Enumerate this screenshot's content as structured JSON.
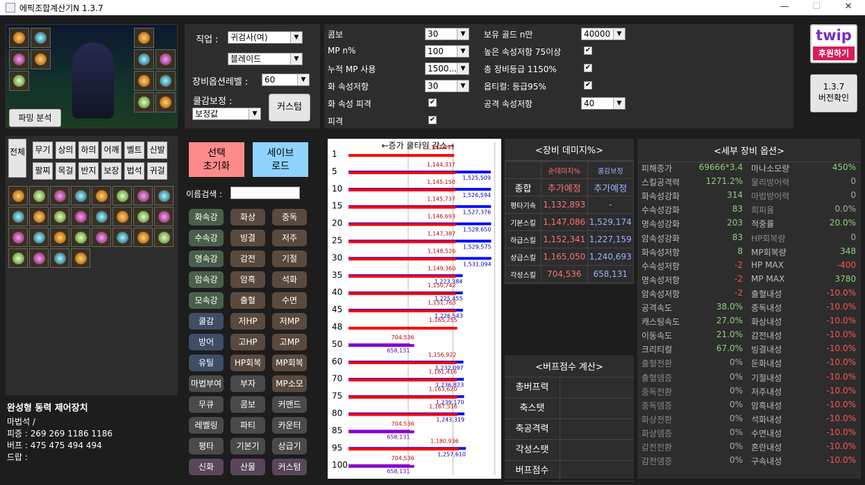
{
  "window": {
    "title": "에픽조합계산기N 1.3.7",
    "minimize": "—",
    "maximize": "☐",
    "close": "✕"
  },
  "preview": {
    "farming_btn": "파밍 분석"
  },
  "job": {
    "label": "직업 :",
    "class_value": "귀검사(여)",
    "subclass_value": "블레이드",
    "level_label": "장비옵션레벨 :",
    "level_value": "60",
    "cool_label": "쿨감보정 :",
    "cool_value": "보정값",
    "custom_btn": "커스텀"
  },
  "params": {
    "left": [
      {
        "label": "콤보",
        "value": "30",
        "type": "combo"
      },
      {
        "label": "MP n%",
        "value": "100",
        "type": "combo"
      },
      {
        "label": "누적 MP 사용",
        "value": "1500...",
        "type": "combo"
      },
      {
        "label": "화 속성저항",
        "value": "30",
        "type": "combo"
      },
      {
        "label": "화 속성 피격",
        "value": "✔",
        "type": "check"
      },
      {
        "label": "피격",
        "value": "✔",
        "type": "check"
      }
    ],
    "right": [
      {
        "label": "보유 골드 n만",
        "value": "40000",
        "type": "combo"
      },
      {
        "label": "높은 속성저항 75이상",
        "value": "✔",
        "type": "check"
      },
      {
        "label": "총 장비등급 1150%",
        "value": "✔",
        "type": "check"
      },
      {
        "label": "옵티컬: 등급95%",
        "value": "✔",
        "type": "check"
      },
      {
        "label": "공격 속성저항",
        "value": "40",
        "type": "combo"
      }
    ]
  },
  "twip": {
    "logo": "twip",
    "support": "후원하기"
  },
  "version_btn": {
    "line1": "1.3.7",
    "line2": "버전확인"
  },
  "slots": {
    "all": "전체",
    "buttons": [
      "무기",
      "상의",
      "하의",
      "어깨",
      "벨트",
      "신발",
      "팔찌",
      "목걸",
      "반지",
      "보장",
      "법석",
      "귀걸"
    ]
  },
  "actions": {
    "reset1": "선택",
    "reset2": "초기화",
    "save1": "세이브",
    "save2": "로드",
    "name_search": "이름검색 :"
  },
  "tags": [
    [
      "화속강",
      "화상",
      "중독",
      "g1",
      "g3",
      "g3"
    ],
    [
      "수속강",
      "빙결",
      "저주",
      "g1",
      "g3",
      "g3"
    ],
    [
      "명속강",
      "감전",
      "기절",
      "g1",
      "g3",
      "g3"
    ],
    [
      "암속강",
      "암흑",
      "석화",
      "g1",
      "g3",
      "g3"
    ],
    [
      "모속강",
      "출혈",
      "수면",
      "g1",
      "g3",
      "g3"
    ],
    [
      "쿨감",
      "저HP",
      "저MP",
      "g2",
      "g3",
      "g3"
    ],
    [
      "방어",
      "고HP",
      "고MP",
      "g2",
      "g3",
      "g3"
    ],
    [
      "유틸",
      "HP회복",
      "MP회복",
      "g2",
      "g3",
      "g3"
    ],
    [
      "마법부여",
      "부자",
      "MP소모",
      "g4",
      "g4",
      "g3"
    ],
    [
      "무큐",
      "콤보",
      "커맨드",
      "g4",
      "g4",
      "g4"
    ],
    [
      "레벨링",
      "파티",
      "카운터",
      "g4",
      "g4",
      "g4"
    ],
    [
      "평타",
      "기본기",
      "상급기",
      "g4",
      "g4",
      "g4"
    ],
    [
      "신화",
      "산물",
      "커스텀",
      "g5",
      "g5",
      "g5"
    ]
  ],
  "item_info": {
    "name": "완성형 동력 제어장치",
    "type": "마법석 /",
    "pijeung": "피증 : 269 269 1186 1186",
    "buff": "버프 : 475 475 494 494",
    "drop": "드랍 :"
  },
  "chart_data": {
    "type": "bar",
    "title": "←증가 쿨타임 감소→",
    "categories": [
      "1",
      "5",
      "10",
      "15",
      "20",
      "25",
      "30",
      "35",
      "40",
      "45",
      "48",
      "50",
      "60",
      "70",
      "75",
      "80",
      "85",
      "95",
      "100"
    ],
    "series": [
      {
        "name": "",
        "color": "#ff0000",
        "values": [
          1132893,
          1144337,
          1145150,
          1145737,
          1146693,
          1147387,
          1148526,
          1149360,
          1150742,
          1151763,
          1165255,
          704536,
          1156922,
          1161416,
          1163620,
          1167516,
          704536,
          1180936,
          704536
        ]
      },
      {
        "name": "",
        "color": "#0000ff",
        "values": [
          null,
          1525509,
          1526594,
          1527376,
          1528650,
          1529575,
          1531094,
          1223384,
          1225455,
          1226543,
          null,
          658131,
          1232097,
          1236823,
          1239170,
          1243319,
          658131,
          1257610,
          658131
        ]
      }
    ],
    "labels_red": [
      "1,132,893",
      "1,144,337",
      "1,145,150",
      "1,145,737",
      "1,146,693",
      "1,147,387",
      "1,148,526",
      "1,149,360",
      "1,150,742",
      "1,151,763",
      "1,165,255",
      "704,536",
      "1,156,922",
      "1,161,416",
      "1,163,620",
      "1,167,516",
      "704,536",
      "1,180,936",
      "704,536"
    ],
    "labels_blue": [
      "",
      "1,525,509",
      "1,526,594",
      "1,527,376",
      "1,528,650",
      "1,529,575",
      "1,531,094",
      "1,223,384",
      "1,225,455",
      "1,226,543",
      "",
      "658,131",
      "1,232,097",
      "1,236,823",
      "1,239,170",
      "1,243,319",
      "658,131",
      "1,257,610",
      "658,131"
    ],
    "purple_rows": [
      11,
      16,
      18
    ],
    "xmax": 1600000
  },
  "damage": {
    "title": "<장비 데미지%>",
    "col1": "순데미지%",
    "col2": "쿨감보정",
    "label_col": "종합",
    "r0": [
      "추가예정",
      "추가예정"
    ],
    "rows": [
      [
        "평타기속",
        "1,132,893",
        "-"
      ],
      [
        "기본스킬",
        "1,147,086",
        "1,529,174"
      ],
      [
        "하급스킬",
        "1,152,341",
        "1,227,159"
      ],
      [
        "상급스킬",
        "1,165,050",
        "1,240,693"
      ],
      [
        "각성스킬",
        "704,536",
        "658,131"
      ]
    ]
  },
  "buffcalc": {
    "title": "<버프점수 계산>",
    "rows": [
      "총버프력",
      "축스탯",
      "축공격력",
      "각성스탯",
      "버프점수"
    ]
  },
  "options": {
    "title": "<세부 장비 옵션>",
    "left": [
      [
        "피해증가",
        "69666*3.4",
        "#8ed17a"
      ],
      [
        "스킬공격력",
        "1271.2%",
        "#8ed17a"
      ],
      [
        "화속성강화",
        "314",
        "#8ed17a"
      ],
      [
        "수속성강화",
        "83",
        "#8ed17a"
      ],
      [
        "명속성강화",
        "203",
        "#8ed17a"
      ],
      [
        "암속성강화",
        "83",
        "#8ed17a"
      ],
      [
        "화속성저항",
        "8",
        "#8ed17a"
      ],
      [
        "수속성저항",
        "-2",
        "#ff5050"
      ],
      [
        "명속성저항",
        "-2",
        "#ff5050"
      ],
      [
        "암속성저항",
        "-2",
        "#ff5050"
      ],
      [
        "공격속도",
        "38.0%",
        "#8ed17a"
      ],
      [
        "캐스팅속도",
        "27.0%",
        "#8ed17a"
      ],
      [
        "이동속도",
        "21.0%",
        "#8ed17a"
      ],
      [
        "크리티컬",
        "67.0%",
        "#8ed17a"
      ],
      [
        "출혈전환",
        "0%",
        "#aaaaaa"
      ],
      [
        "출혈뎀증",
        "0%",
        "#aaaaaa"
      ],
      [
        "중독전환",
        "0%",
        "#aaaaaa"
      ],
      [
        "중독뎀증",
        "0%",
        "#aaaaaa"
      ],
      [
        "화상전환",
        "0%",
        "#aaaaaa"
      ],
      [
        "화상뎀증",
        "0%",
        "#aaaaaa"
      ],
      [
        "감전전환",
        "0%",
        "#aaaaaa"
      ],
      [
        "감전뎀증",
        "0%",
        "#aaaaaa"
      ]
    ],
    "right": [
      [
        "마나소모량",
        "450%",
        "#8ed17a"
      ],
      [
        "물리방어력",
        "0",
        "#aaaaaa"
      ],
      [
        "마법방어력",
        "0",
        "#aaaaaa"
      ],
      [
        "회피율",
        "0.0%",
        "#aaaaaa"
      ],
      [
        "적중률",
        "20.0%",
        "#8ed17a"
      ],
      [
        "HP회복량",
        "0",
        "#aaaaaa"
      ],
      [
        "MP회복량",
        "348",
        "#8ed17a"
      ],
      [
        "HP MAX",
        "-400",
        "#ff5050"
      ],
      [
        "MP MAX",
        "3780",
        "#8ed17a"
      ],
      [
        "출혈내성",
        "-10.0%",
        "#ff5050"
      ],
      [
        "중독내성",
        "-10.0%",
        "#ff5050"
      ],
      [
        "화상내성",
        "-10.0%",
        "#ff5050"
      ],
      [
        "감전내성",
        "-10.0%",
        "#ff5050"
      ],
      [
        "빙결내성",
        "-10.0%",
        "#ff5050"
      ],
      [
        "둔화내성",
        "-10.0%",
        "#ff5050"
      ],
      [
        "기절내성",
        "-10.0%",
        "#ff5050"
      ],
      [
        "저주내성",
        "-10.0%",
        "#ff5050"
      ],
      [
        "암흑내성",
        "-10.0%",
        "#ff5050"
      ],
      [
        "석화내성",
        "-10.0%",
        "#ff5050"
      ],
      [
        "수면내성",
        "-10.0%",
        "#ff5050"
      ],
      [
        "혼란내성",
        "-10.0%",
        "#ff5050"
      ],
      [
        "구속내성",
        "-10.0%",
        "#ff5050"
      ]
    ]
  }
}
